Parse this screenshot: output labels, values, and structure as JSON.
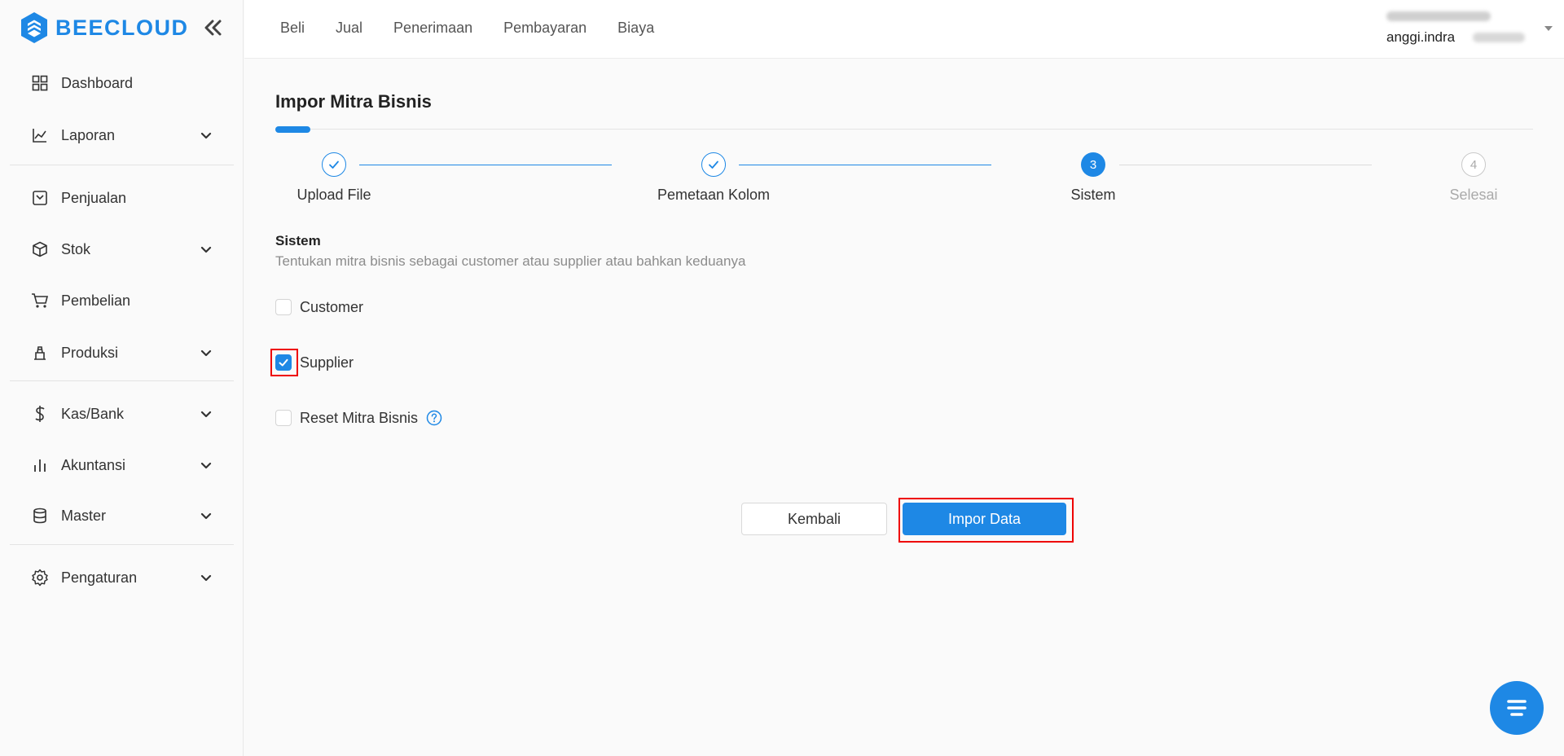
{
  "brand": {
    "name": "BEECLOUD",
    "color": "#1e88e5"
  },
  "sidebar": {
    "items": [
      {
        "label": "Dashboard",
        "icon": "grid-icon"
      },
      {
        "label": "Laporan",
        "icon": "chart-line-icon",
        "expandable": true
      },
      {
        "label": "Penjualan",
        "icon": "receipt-icon"
      },
      {
        "label": "Stok",
        "icon": "box-icon",
        "expandable": true
      },
      {
        "label": "Pembelian",
        "icon": "cart-icon"
      },
      {
        "label": "Produksi",
        "icon": "factory-icon",
        "expandable": true
      },
      {
        "label": "Kas/Bank",
        "icon": "dollar-icon",
        "expandable": true
      },
      {
        "label": "Akuntansi",
        "icon": "bar-chart-icon",
        "expandable": true
      },
      {
        "label": "Master",
        "icon": "database-icon",
        "expandable": true
      },
      {
        "label": "Pengaturan",
        "icon": "gear-icon",
        "expandable": true
      }
    ]
  },
  "topnav": {
    "items": [
      "Beli",
      "Jual",
      "Penerimaan",
      "Pembayaran",
      "Biaya"
    ]
  },
  "user": {
    "email": "anggi.indra"
  },
  "page": {
    "title": "Impor Mitra Bisnis"
  },
  "steps": [
    {
      "number": "1",
      "label": "Upload File",
      "state": "done"
    },
    {
      "number": "2",
      "label": "Pemetaan Kolom",
      "state": "done"
    },
    {
      "number": "3",
      "label": "Sistem",
      "state": "active"
    },
    {
      "number": "4",
      "label": "Selesai",
      "state": "pending"
    }
  ],
  "section": {
    "title": "Sistem",
    "description": "Tentukan mitra bisnis sebagai customer atau supplier atau bahkan keduanya"
  },
  "options": {
    "customer": {
      "label": "Customer",
      "checked": false
    },
    "supplier": {
      "label": "Supplier",
      "checked": true
    },
    "reset": {
      "label": "Reset Mitra Bisnis",
      "checked": false
    }
  },
  "buttons": {
    "back": "Kembali",
    "import": "Impor Data"
  },
  "colors": {
    "accent": "#1e88e5",
    "highlight": "#e00000"
  }
}
